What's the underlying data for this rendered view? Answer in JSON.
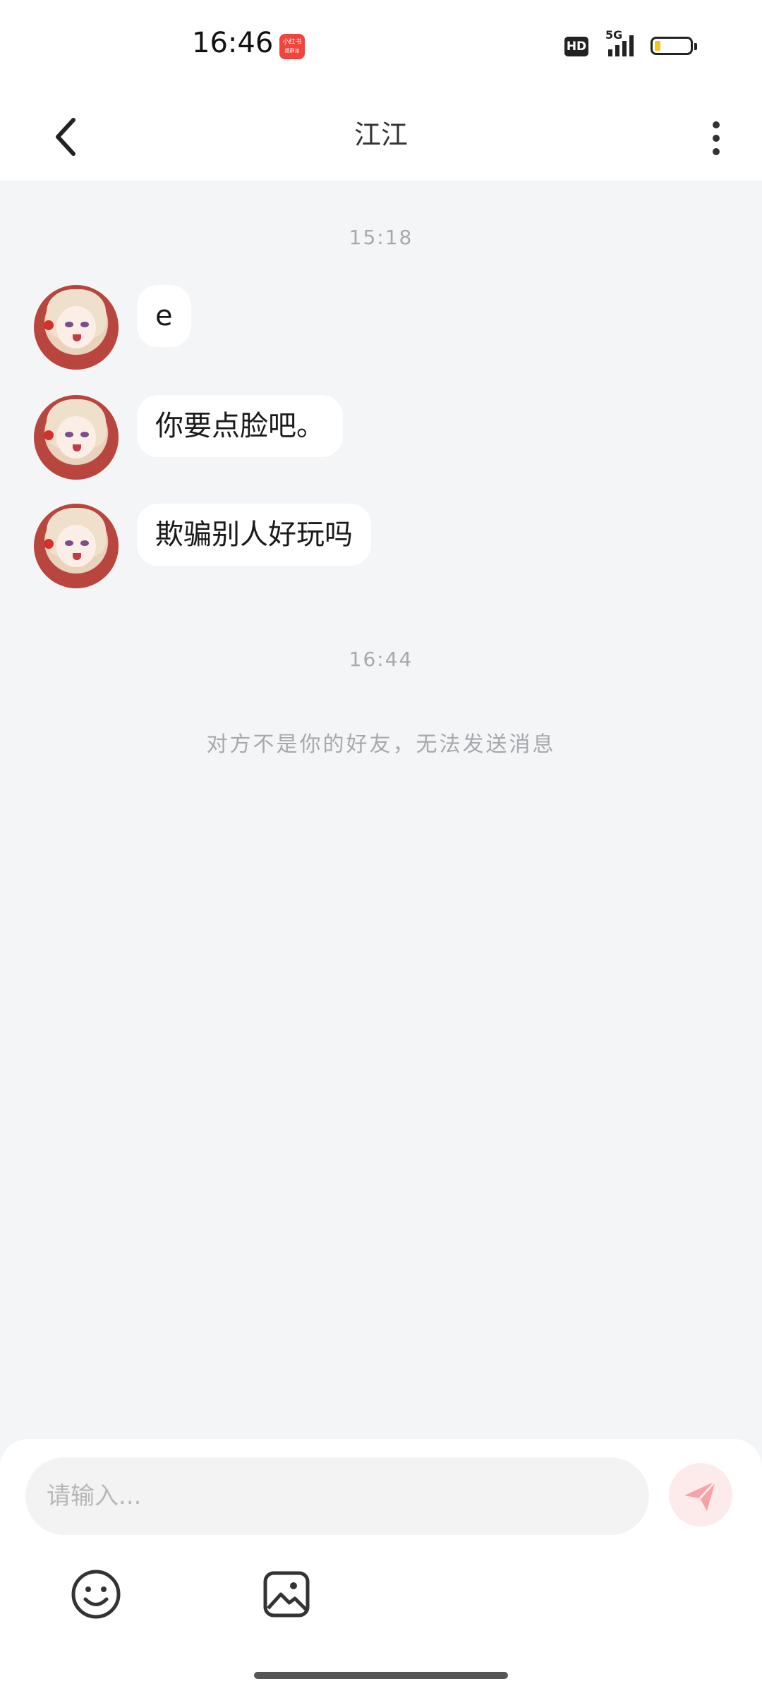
{
  "status_bar": {
    "time": "16:46",
    "app_icon_text": "小红书",
    "app_icon_subtext": "超群派",
    "hd_label": "HD",
    "network_label": "5G"
  },
  "header": {
    "title": "江江"
  },
  "messages": [
    {
      "text": "e"
    },
    {
      "text": "你要点脸吧。"
    },
    {
      "text": "欺骗别人好玩吗"
    }
  ],
  "timestamps": [
    "15:18",
    "16:44"
  ],
  "notice": "对方不是你的好友，无法发送消息",
  "composer": {
    "placeholder": "请输入..."
  },
  "colors": {
    "accent_send": "#f6a3a8",
    "battery_level": "#f5c518"
  },
  "icons": {
    "back": "chevron-left-icon",
    "more": "more-vertical-icon",
    "send": "send-icon",
    "emoji": "smiley-icon",
    "image": "image-icon"
  }
}
